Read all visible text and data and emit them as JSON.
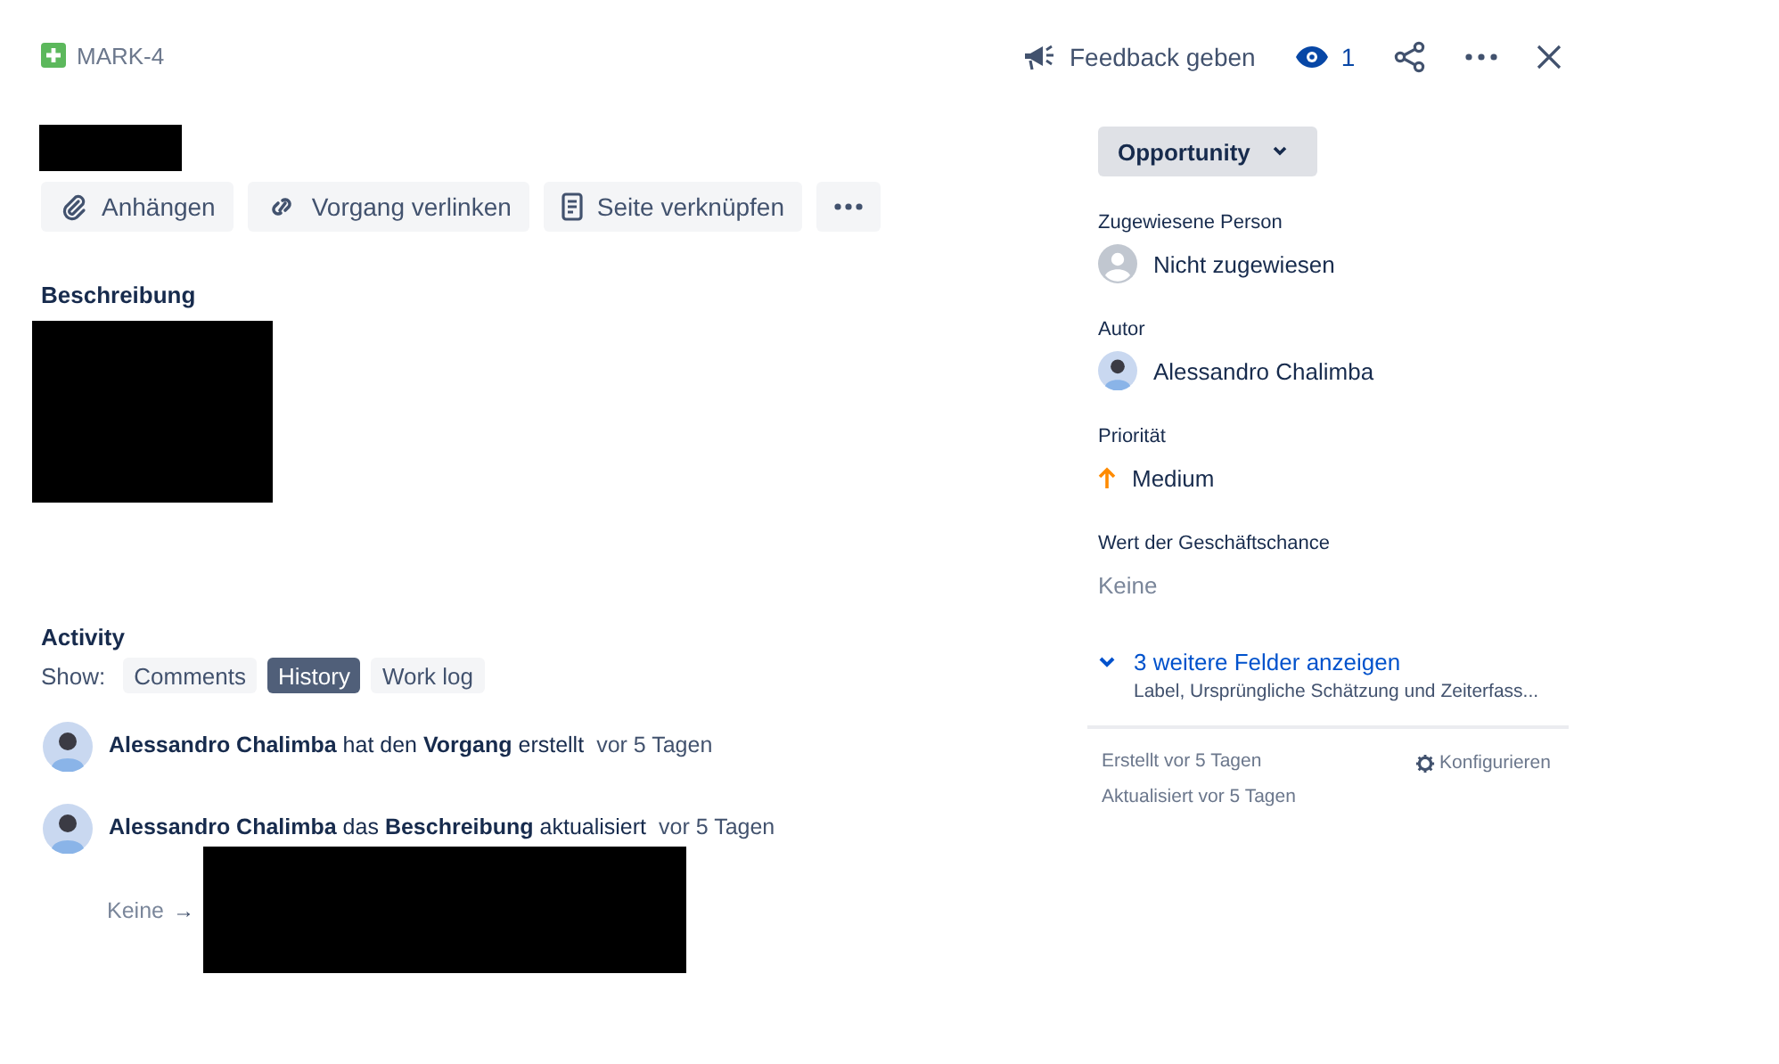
{
  "issue_key": "MARK-4",
  "header_actions": {
    "feedback": "Feedback geben",
    "watchers": "1"
  },
  "toolbar": [
    {
      "kind": "attach",
      "label": "Anhängen"
    },
    {
      "kind": "link",
      "label": "Vorgang verlinken"
    },
    {
      "kind": "page",
      "label": "Seite verknüpfen"
    },
    {
      "kind": "more"
    }
  ],
  "description_heading": "Beschreibung",
  "activity": {
    "heading": "Activity",
    "show_label": "Show:",
    "tabs": [
      {
        "label": "Comments",
        "selected": false
      },
      {
        "label": "History",
        "selected": true
      },
      {
        "label": "Work log",
        "selected": false
      }
    ],
    "entries": [
      {
        "text": "**Alessandro Chalimba** hat den **Vorgang** erstellt",
        "time": "vor 5 Tagen"
      },
      {
        "text": "**Alessandro Chalimba** das **Beschreibung** aktualisiert",
        "time": "vor 5 Tagen",
        "old_value": "Keine",
        "arrow": "→"
      }
    ]
  },
  "status_button": "Opportunity",
  "fields": [
    {
      "kind": "unassigned",
      "label": "Zugewiesene Person",
      "value": "Nicht zugewiesen"
    },
    {
      "kind": "person",
      "label": "Autor",
      "value": "Alessandro Chalimba"
    },
    {
      "kind": "priority",
      "label": "Priorität",
      "value": "Medium"
    },
    {
      "kind": "empty",
      "label": "Wert der Geschäftschance",
      "value": "Keine"
    }
  ],
  "more_fields": {
    "label": "3 weitere Felder anzeigen",
    "hint": "Label, Ursprüngliche Schätzung und Zeiterfass..."
  },
  "footer": {
    "created": "Erstellt vor 5 Tagen",
    "updated": "Aktualisiert vor 5 Tagen",
    "configure": "Konfigurieren"
  }
}
